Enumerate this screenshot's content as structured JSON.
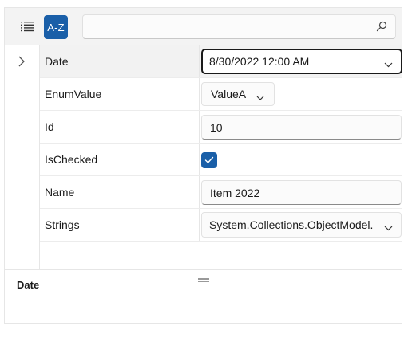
{
  "toolbar": {
    "categorized_icon": "list-icon",
    "sort_az_label": "A-Z",
    "search": {
      "value": "",
      "placeholder": ""
    },
    "search_icon": "search-icon"
  },
  "grid": {
    "rows": [
      {
        "label": "Date",
        "value": "8/30/2022 12:00 AM",
        "editor": "datepicker"
      },
      {
        "label": "EnumValue",
        "value": "ValueA",
        "editor": "dropdown"
      },
      {
        "label": "Id",
        "value": "10",
        "editor": "textbox"
      },
      {
        "label": "IsChecked",
        "value": "checked",
        "editor": "checkbox"
      },
      {
        "label": "Name",
        "value": "Item 2022",
        "editor": "textbox"
      },
      {
        "label": "Strings",
        "value": "System.Collections.ObjectModel.ObservableCollection",
        "editor": "dropdown"
      }
    ],
    "selected_row": "Date"
  },
  "description": {
    "title": "Date"
  },
  "colors": {
    "accent": "#1a5fa8",
    "toolbar_bg": "#f3f3f3",
    "selected_row_bg": "#f2f2f2"
  }
}
